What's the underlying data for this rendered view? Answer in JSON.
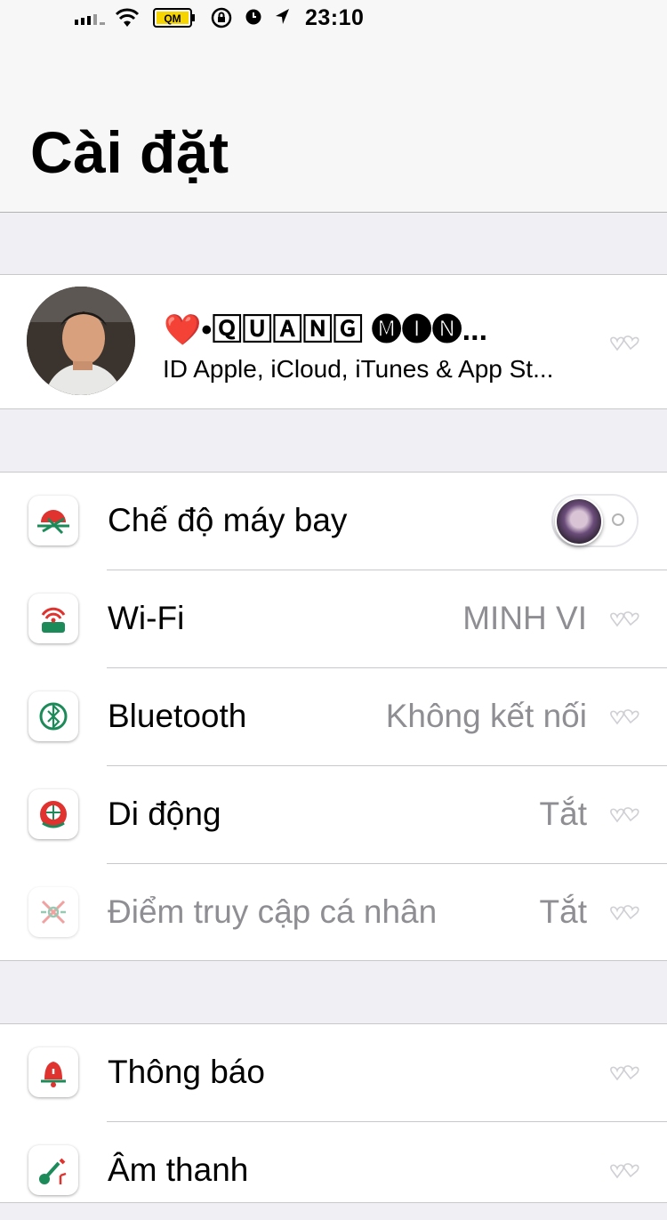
{
  "status": {
    "time": "23:10",
    "battery_label": "QM"
  },
  "header": {
    "title": "Cài đặt"
  },
  "profile": {
    "name": "❤️•🅀🅄🄰🄽🄶 🅜🅘🅝...",
    "subtitle": "ID Apple, iCloud, iTunes & App St..."
  },
  "group1": [
    {
      "label": "Chế độ máy bay",
      "toggle": "off",
      "icon": "airplane-icon"
    },
    {
      "label": "Wi-Fi",
      "value": "MINH VI",
      "icon": "wifi-icon"
    },
    {
      "label": "Bluetooth",
      "value": "Không kết nối",
      "icon": "bluetooth-icon"
    },
    {
      "label": "Di động",
      "value": "Tắt",
      "icon": "cellular-icon"
    },
    {
      "label": "Điểm truy cập cá nhân",
      "value": "Tắt",
      "icon": "hotspot-icon"
    }
  ],
  "group2": [
    {
      "label": "Thông báo",
      "icon": "notifications-icon"
    },
    {
      "label": "Âm thanh",
      "icon": "sounds-icon"
    }
  ],
  "colors": {
    "background": "#efeff4",
    "accent_red": "#e0322e",
    "secondary_text": "#8e8e93"
  }
}
